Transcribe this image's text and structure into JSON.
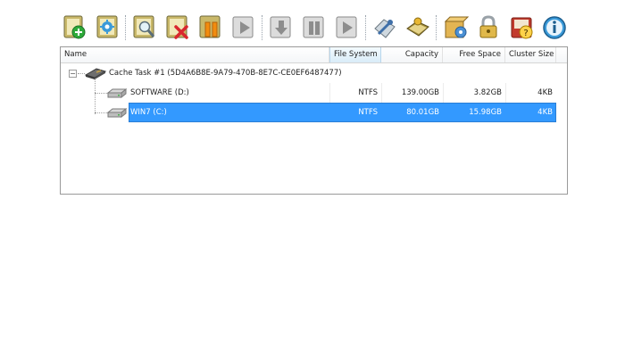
{
  "toolbar": {
    "buttons": [
      {
        "icon": "add-task-icon"
      },
      {
        "icon": "settings-task-icon"
      },
      {
        "icon": "inspect-task-icon"
      },
      {
        "icon": "delete-task-icon"
      },
      {
        "icon": "pause-icon"
      },
      {
        "icon": "play-icon"
      },
      {
        "icon": "download-icon"
      },
      {
        "icon": "pause-gray-icon"
      },
      {
        "icon": "play-gray-icon"
      },
      {
        "icon": "tools-icon"
      },
      {
        "icon": "key-book-icon"
      },
      {
        "icon": "options-box-icon"
      },
      {
        "icon": "lock-icon"
      },
      {
        "icon": "help-icon"
      },
      {
        "icon": "info-icon"
      }
    ]
  },
  "columns": {
    "name": "Name",
    "file_system": "File System",
    "capacity": "Capacity",
    "free_space": "Free Space",
    "cluster_size": "Cluster Size"
  },
  "task": {
    "label": "Cache Task #1 (5D4A6B8E-9A79-470B-8E7C-CE0EF6487477)",
    "expander": "−"
  },
  "drives": [
    {
      "name": "SOFTWARE (D:)",
      "file_system": "NTFS",
      "capacity": "139.00GB",
      "free_space": "3.82GB",
      "cluster_size": "4KB",
      "selected": false
    },
    {
      "name": "WIN7 (C:)",
      "file_system": "NTFS",
      "capacity": "80.01GB",
      "free_space": "15.98GB",
      "cluster_size": "4KB",
      "selected": true
    }
  ],
  "colors": {
    "selection": "#3399ff",
    "accent_green": "#2eaa3a",
    "accent_red": "#d9272e",
    "accent_orange": "#f28c0f"
  }
}
